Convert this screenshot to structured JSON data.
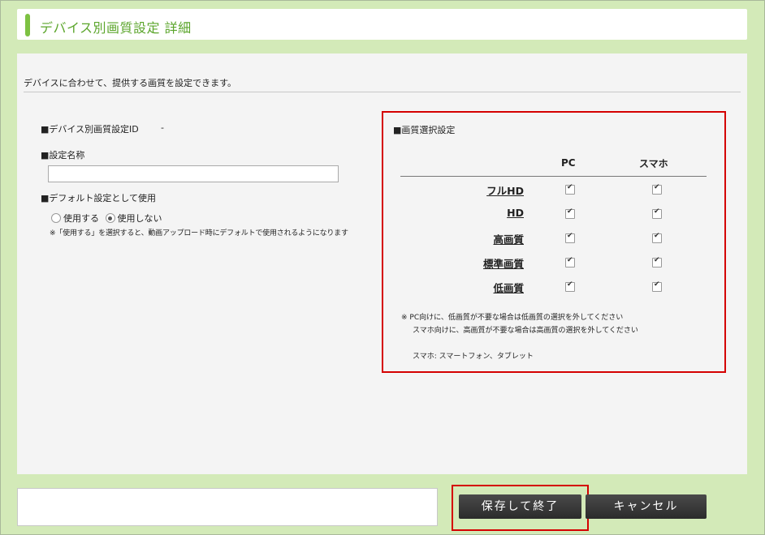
{
  "page_title": "デバイス別画質設定 詳細",
  "intro": "デバイスに合わせて、提供する画質を設定できます。",
  "left": {
    "id_label": "■デバイス別画質設定ID",
    "id_value": "-",
    "name_label": "■設定名称",
    "name_value": "",
    "default_label": "■デフォルト設定として使用",
    "radio_use": "使用する",
    "radio_not_use": "使用しない",
    "selected_option": "使用しない",
    "note": "※「使用する」を選択すると、動画アップロード時にデフォルトで使用されるようになります"
  },
  "quality": {
    "heading": "■画質選択設定",
    "col_pc": "PC",
    "col_sp": "スマホ",
    "rows": [
      {
        "name": "フルHD",
        "pc": true,
        "sp": true
      },
      {
        "name": "HD",
        "pc": true,
        "sp": true
      },
      {
        "name": "高画質",
        "pc": true,
        "sp": true
      },
      {
        "name": "標準画質",
        "pc": true,
        "sp": true
      },
      {
        "name": "低画質",
        "pc": true,
        "sp": true
      }
    ],
    "note1": "※ PC向けに、低画質が不要な場合は低画質の選択を外してください",
    "note2": "スマホ向けに、高画質が不要な場合は高画質の選択を外してください",
    "note3": "スマホ: スマートフォン、タブレット"
  },
  "buttons": {
    "save": "保存して終了",
    "cancel": "キャンセル"
  },
  "colors": {
    "accent_green": "#7dc142",
    "highlight_red": "#d40000",
    "background": "#d3eab8"
  }
}
